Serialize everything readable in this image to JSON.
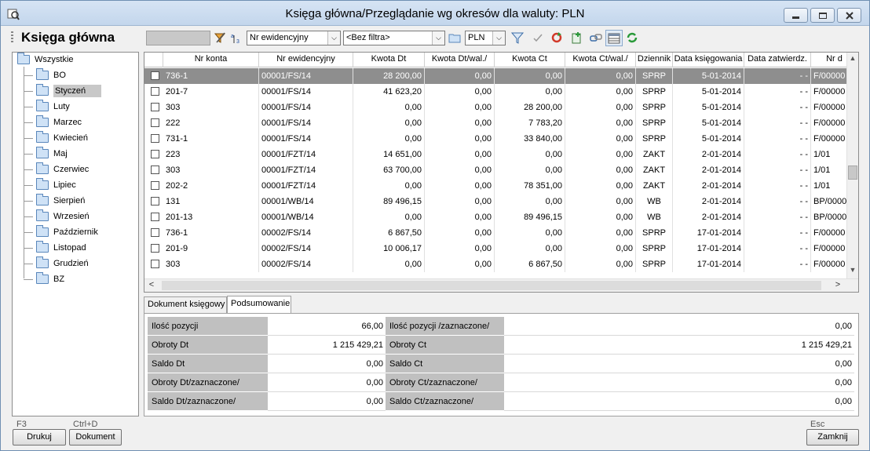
{
  "window": {
    "title": "Księga główna/Przeglądanie wg okresów dla waluty: PLN"
  },
  "toolbar": {
    "module_title": "Księga główna",
    "sort_field": "Nr ewidencyjny",
    "filter": "<Bez filtra>",
    "currency": "PLN"
  },
  "tree": {
    "root": "Wszystkie",
    "items": [
      "BO",
      "Styczeń",
      "Luty",
      "Marzec",
      "Kwiecień",
      "Maj",
      "Czerwiec",
      "Lipiec",
      "Sierpień",
      "Wrzesień",
      "Październik",
      "Listopad",
      "Grudzień",
      "BZ"
    ],
    "selected": "Styczeń"
  },
  "grid": {
    "columns": [
      "Nr konta",
      "Nr ewidencyjny",
      "Kwota Dt",
      "Kwota Dt/wal./",
      "Kwota Ct",
      "Kwota Ct/wal./",
      "Dziennik",
      "Data księgowania",
      "Data zatwierdz.",
      "Nr d"
    ],
    "rows": [
      {
        "konto": "736-1",
        "ewid": "00001/FS/14",
        "dt": "28 200,00",
        "dtw": "0,00",
        "ct": "0,00",
        "ctw": "0,00",
        "dziennik": "SPRP",
        "data_ks": "5-01-2014",
        "data_zat": "- -",
        "nrd": "F/00000"
      },
      {
        "konto": "201-7",
        "ewid": "00001/FS/14",
        "dt": "41 623,20",
        "dtw": "0,00",
        "ct": "0,00",
        "ctw": "0,00",
        "dziennik": "SPRP",
        "data_ks": "5-01-2014",
        "data_zat": "- -",
        "nrd": "F/00000"
      },
      {
        "konto": "303",
        "ewid": "00001/FS/14",
        "dt": "0,00",
        "dtw": "0,00",
        "ct": "28 200,00",
        "ctw": "0,00",
        "dziennik": "SPRP",
        "data_ks": "5-01-2014",
        "data_zat": "- -",
        "nrd": "F/00000"
      },
      {
        "konto": "222",
        "ewid": "00001/FS/14",
        "dt": "0,00",
        "dtw": "0,00",
        "ct": "7 783,20",
        "ctw": "0,00",
        "dziennik": "SPRP",
        "data_ks": "5-01-2014",
        "data_zat": "- -",
        "nrd": "F/00000"
      },
      {
        "konto": "731-1",
        "ewid": "00001/FS/14",
        "dt": "0,00",
        "dtw": "0,00",
        "ct": "33 840,00",
        "ctw": "0,00",
        "dziennik": "SPRP",
        "data_ks": "5-01-2014",
        "data_zat": "- -",
        "nrd": "F/00000"
      },
      {
        "konto": "223",
        "ewid": "00001/FZT/14",
        "dt": "14 651,00",
        "dtw": "0,00",
        "ct": "0,00",
        "ctw": "0,00",
        "dziennik": "ZAKT",
        "data_ks": "2-01-2014",
        "data_zat": "- -",
        "nrd": "1/01"
      },
      {
        "konto": "303",
        "ewid": "00001/FZT/14",
        "dt": "63 700,00",
        "dtw": "0,00",
        "ct": "0,00",
        "ctw": "0,00",
        "dziennik": "ZAKT",
        "data_ks": "2-01-2014",
        "data_zat": "- -",
        "nrd": "1/01"
      },
      {
        "konto": "202-2",
        "ewid": "00001/FZT/14",
        "dt": "0,00",
        "dtw": "0,00",
        "ct": "78 351,00",
        "ctw": "0,00",
        "dziennik": "ZAKT",
        "data_ks": "2-01-2014",
        "data_zat": "- -",
        "nrd": "1/01"
      },
      {
        "konto": "131",
        "ewid": "00001/WB/14",
        "dt": "89 496,15",
        "dtw": "0,00",
        "ct": "0,00",
        "ctw": "0,00",
        "dziennik": "WB",
        "data_ks": "2-01-2014",
        "data_zat": "- -",
        "nrd": "BP/0000"
      },
      {
        "konto": "201-13",
        "ewid": "00001/WB/14",
        "dt": "0,00",
        "dtw": "0,00",
        "ct": "89 496,15",
        "ctw": "0,00",
        "dziennik": "WB",
        "data_ks": "2-01-2014",
        "data_zat": "- -",
        "nrd": "BP/0000"
      },
      {
        "konto": "736-1",
        "ewid": "00002/FS/14",
        "dt": "6 867,50",
        "dtw": "0,00",
        "ct": "0,00",
        "ctw": "0,00",
        "dziennik": "SPRP",
        "data_ks": "17-01-2014",
        "data_zat": "- -",
        "nrd": "F/00000"
      },
      {
        "konto": "201-9",
        "ewid": "00002/FS/14",
        "dt": "10 006,17",
        "dtw": "0,00",
        "ct": "0,00",
        "ctw": "0,00",
        "dziennik": "SPRP",
        "data_ks": "17-01-2014",
        "data_zat": "- -",
        "nrd": "F/00000"
      },
      {
        "konto": "303",
        "ewid": "00002/FS/14",
        "dt": "0,00",
        "dtw": "0,00",
        "ct": "6 867,50",
        "ctw": "0,00",
        "dziennik": "SPRP",
        "data_ks": "17-01-2014",
        "data_zat": "- -",
        "nrd": "F/00000"
      }
    ]
  },
  "tabs": [
    "Dokument księgowy",
    "Podsumowanie"
  ],
  "summary": {
    "left": [
      {
        "label": "Ilość pozycji",
        "value": "66,00"
      },
      {
        "label": "Obroty Dt",
        "value": "1 215 429,21"
      },
      {
        "label": "Saldo Dt",
        "value": "0,00"
      },
      {
        "label": "Obroty Dt/zaznaczone/",
        "value": "0,00"
      },
      {
        "label": "Saldo Dt/zaznaczone/",
        "value": "0,00"
      }
    ],
    "right": [
      {
        "label": "Ilość pozycji /zaznaczone/",
        "value": "0,00"
      },
      {
        "label": "Obroty Ct",
        "value": "1 215 429,21"
      },
      {
        "label": "Saldo Ct",
        "value": "0,00"
      },
      {
        "label": "Obroty Ct/zaznaczone/",
        "value": "0,00"
      },
      {
        "label": "Saldo Ct/zaznaczone/",
        "value": "0,00"
      }
    ]
  },
  "buttons": {
    "print_shortcut": "F3",
    "print_label": "Drukuj",
    "document_shortcut": "Ctrl+D",
    "document_label": "Dokument",
    "close_shortcut": "Esc",
    "close_label": "Zamknij"
  }
}
